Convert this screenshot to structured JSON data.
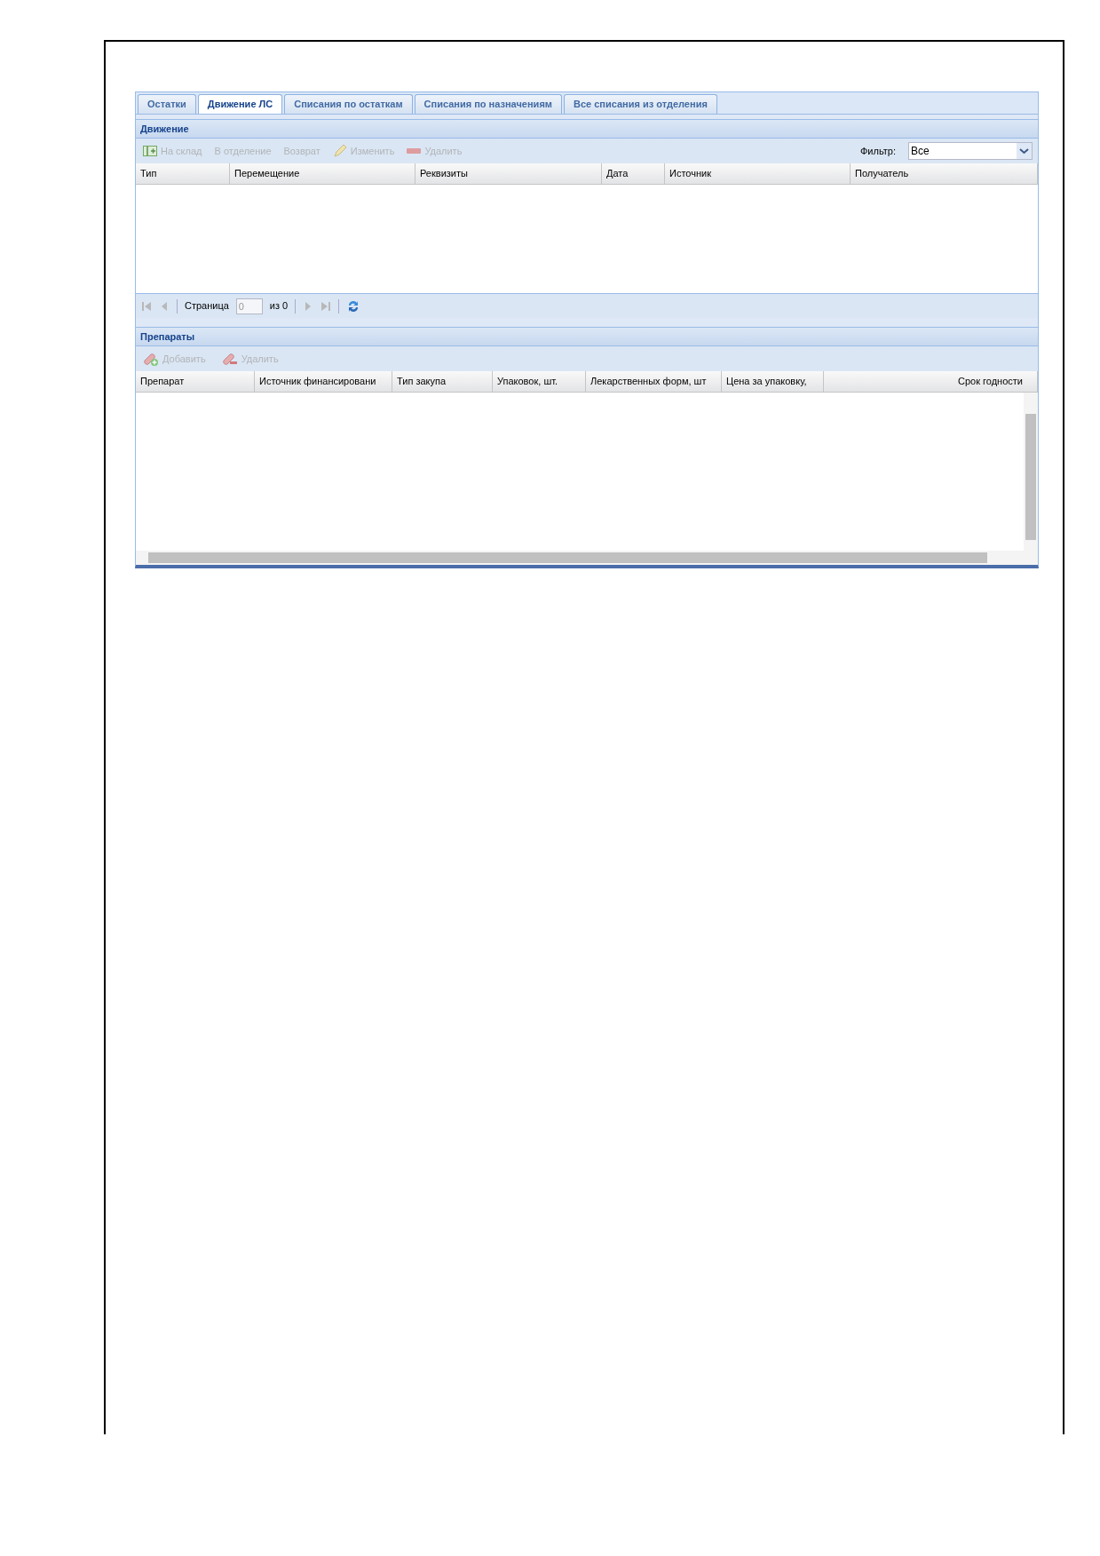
{
  "tabs": [
    {
      "label": "Остатки",
      "selected": false
    },
    {
      "label": "Движение ЛС",
      "selected": true
    },
    {
      "label": "Списания по остаткам",
      "selected": false
    },
    {
      "label": "Списания по назначениям",
      "selected": false
    },
    {
      "label": "Все списания из отделения",
      "selected": false
    }
  ],
  "movement": {
    "title": "Движение",
    "toolbar": [
      {
        "kind": "stock",
        "label": "На склад",
        "disabled": true
      },
      {
        "kind": "plain",
        "label": "В отделение",
        "disabled": true
      },
      {
        "kind": "plain",
        "label": "Возврат",
        "disabled": true
      },
      {
        "kind": "edit",
        "label": "Изменить",
        "disabled": true
      },
      {
        "kind": "delete",
        "label": "Удалить",
        "disabled": true
      }
    ],
    "filter": {
      "label": "Фильтр:",
      "value": "Все"
    },
    "columns": [
      "Тип",
      "Перемещение",
      "Реквизиты",
      "Дата",
      "Источник",
      "Получатель"
    ],
    "pager": {
      "page_label": "Страница",
      "page_value": "0",
      "of_label": "из 0"
    }
  },
  "drugs": {
    "title": "Препараты",
    "toolbar": [
      {
        "kind": "add",
        "label": "Добавить",
        "disabled": true
      },
      {
        "kind": "remove",
        "label": "Удалить",
        "disabled": true
      }
    ],
    "columns": [
      "Препарат",
      "Источник финансировани",
      "Тип закупа",
      "Упаковок, шт.",
      "Лекарственных форм, шт",
      "Цена за упаковку,",
      "Срок годности"
    ]
  }
}
